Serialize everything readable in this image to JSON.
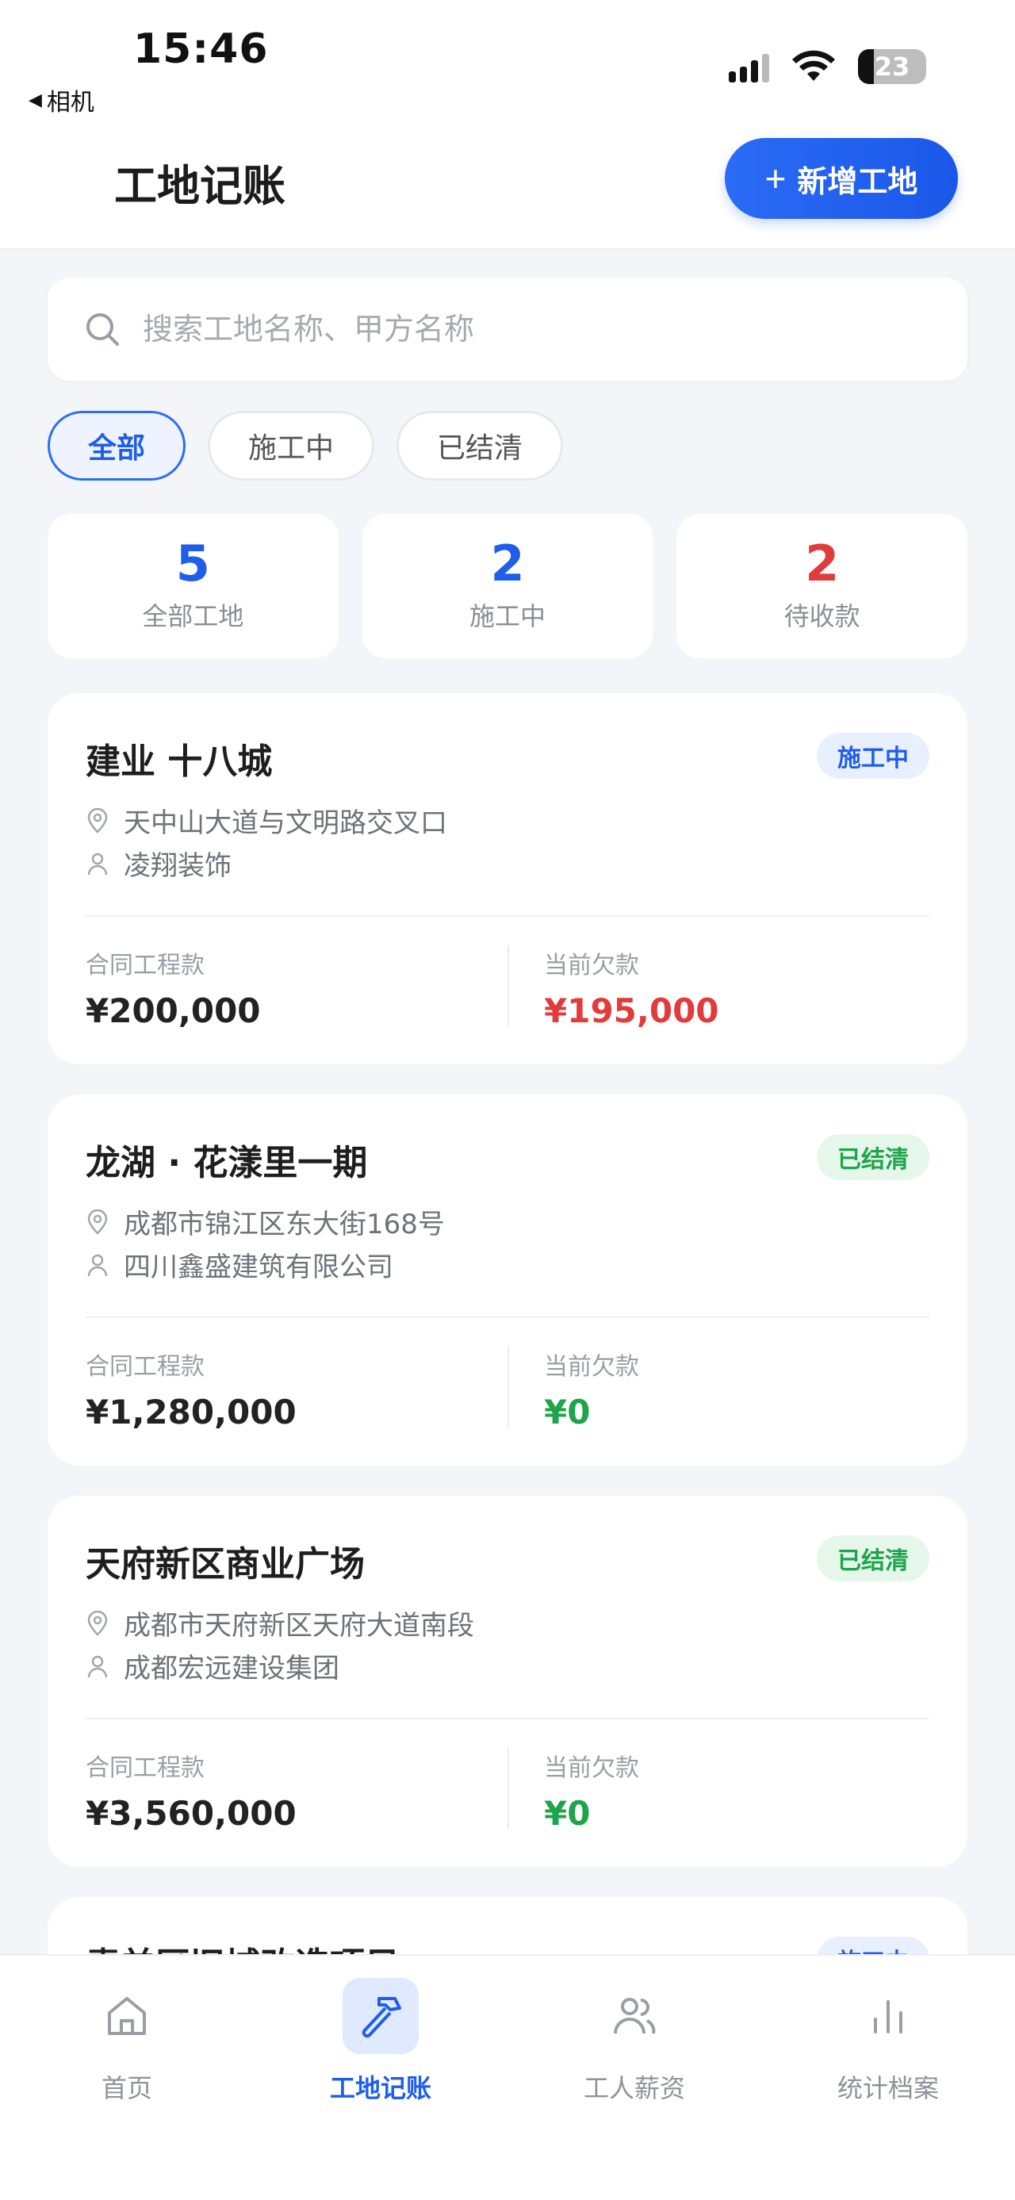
{
  "status_bar": {
    "time": "15:46",
    "back_app": "相机",
    "battery": "23"
  },
  "header": {
    "title": "工地记账",
    "add_button": "新增工地"
  },
  "search": {
    "placeholder": "搜索工地名称、甲方名称"
  },
  "filters": [
    {
      "label": "全部",
      "active": true
    },
    {
      "label": "施工中",
      "active": false
    },
    {
      "label": "已结清",
      "active": false
    }
  ],
  "stats": [
    {
      "value": "5",
      "label": "全部工地",
      "color": "#1f5ee9"
    },
    {
      "value": "2",
      "label": "施工中",
      "color": "#1f5ee9"
    },
    {
      "value": "2",
      "label": "待收款",
      "color": "#e23b3b"
    }
  ],
  "sites": [
    {
      "name": "建业 十八城",
      "status": "施工中",
      "address": "天中山大道与文明路交叉口",
      "client": "凌翔装饰",
      "contract_label": "合同工程款",
      "contract_amount": "¥200,000",
      "debt_label": "当前欠款",
      "debt_amount": "¥195,000"
    },
    {
      "name": "龙湖 · 花漾里一期",
      "status": "已结清",
      "address": "成都市锦江区东大街168号",
      "client": "四川鑫盛建筑有限公司",
      "contract_label": "合同工程款",
      "contract_amount": "¥1,280,000",
      "debt_label": "当前欠款",
      "debt_amount": "¥0"
    },
    {
      "name": "天府新区商业广场",
      "status": "已结清",
      "address": "成都市天府新区天府大道南段",
      "client": "成都宏远建设集团",
      "contract_label": "合同工程款",
      "contract_amount": "¥3,560,000",
      "debt_label": "当前欠款",
      "debt_amount": "¥0"
    },
    {
      "name": "青羊区旧城改造项目",
      "status": "施工中"
    }
  ],
  "tabs": [
    {
      "label": "首页",
      "icon": "home-icon",
      "active": false
    },
    {
      "label": "工地记账",
      "icon": "hammer-icon",
      "active": true
    },
    {
      "label": "工人薪资",
      "icon": "users-icon",
      "active": false
    },
    {
      "label": "统计档案",
      "icon": "bar-chart-icon",
      "active": false
    }
  ],
  "colors": {
    "accent": "#1f5ee9",
    "debt_red": "#e23b3b",
    "settled_green": "#1ea44a"
  }
}
